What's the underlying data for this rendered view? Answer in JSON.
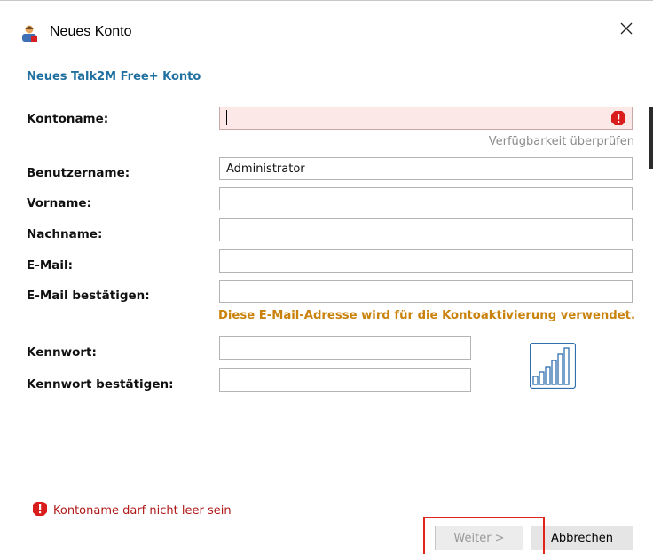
{
  "window": {
    "title": "Neues Konto",
    "icon": "user-account-icon",
    "close_icon": "close-icon"
  },
  "form": {
    "subtitle": "Neues Talk2M Free+ Konto",
    "account_name": {
      "label": "Kontoname:",
      "value": "",
      "state": "error"
    },
    "availability_link": "Verfügbarkeit überprüfen",
    "username": {
      "label": "Benutzername:",
      "value": "Administrator"
    },
    "first_name": {
      "label": "Vorname:",
      "value": ""
    },
    "last_name": {
      "label": "Nachname:",
      "value": ""
    },
    "email": {
      "label": "E-Mail:",
      "value": ""
    },
    "email_confirm": {
      "label": "E-Mail bestätigen:",
      "value": ""
    },
    "email_note": "Diese E-Mail-Adresse wird für die Kontoaktivierung verwendet.",
    "password": {
      "label": "Kennwort:",
      "value": ""
    },
    "password_confirm": {
      "label": "Kennwort bestätigen:",
      "value": ""
    },
    "password_strength_icon": "password-strength-bars-icon"
  },
  "validation": {
    "message": "Kontoname darf nicht leer sein",
    "icon": "error-icon"
  },
  "buttons": {
    "next": "Weiter >",
    "next_enabled": false,
    "cancel": "Abbrechen"
  },
  "colors": {
    "subtitle": "#1f6fa0",
    "note": "#c9820b",
    "error": "#b01818",
    "error_field_bg": "#fde8e8",
    "highlight": "#e0241b"
  }
}
